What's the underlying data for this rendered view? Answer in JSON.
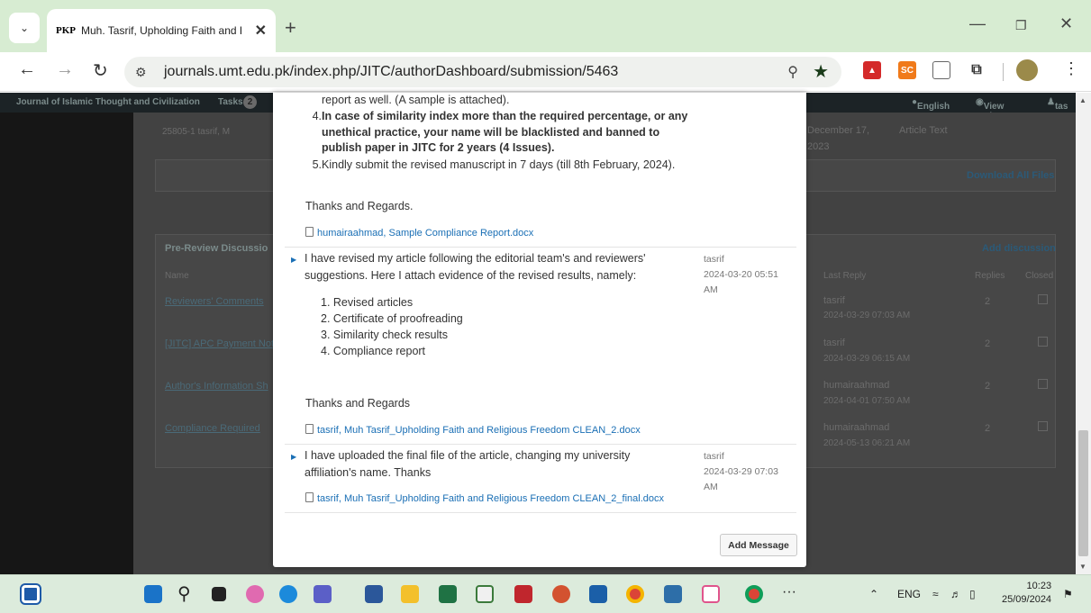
{
  "browser": {
    "tab_title": "Muh. Tasrif, Upholding Faith and Relig",
    "tab_favicon": "PKP",
    "url": "journals.umt.edu.pk/index.php/JITC/authorDashboard/submission/5463",
    "ext_sc": "SC"
  },
  "site": {
    "journal_name": "Journal of Islamic Thought and Civilization",
    "tasks_label": "Tasks",
    "tasks_count": "2",
    "lang": "English",
    "view_site": "View Site",
    "user": "tas",
    "file_row": "25805-1   tasrif, M",
    "file_date": "December 17,",
    "file_year": "2023",
    "file_type": "Article Text",
    "download_all": "Download All Files",
    "discussions_title": "Pre-Review Discussio",
    "add_discussion": "Add discussion",
    "col_name": "Name",
    "col_last_reply": "Last Reply",
    "col_replies": "Replies",
    "col_closed": "Closed",
    "rows": [
      {
        "name": "Reviewers' Comments",
        "user": "tasrif",
        "date": "2024-03-29 07:03 AM",
        "replies": "2"
      },
      {
        "name": "[JITC] APC Payment Noti",
        "user": "tasrif",
        "date": "2024-03-29 06:15 AM",
        "replies": "2"
      },
      {
        "name": "Author's Information Sh",
        "user": "humairaahmad",
        "date": "2024-04-01 07:50 AM",
        "replies": "2"
      },
      {
        "name": "Compliance Required",
        "user": "humairaahmad",
        "date": "2024-05-13 06:21 AM",
        "replies": "2"
      }
    ]
  },
  "modal": {
    "item3_tail": "report as well. (A sample is attached).",
    "item4_num": "4.",
    "item4_text": "In case of similarity index more than the required percentage, or any unethical practice, your name will be blacklisted and banned to publish paper in JITC for 2 years (4 Issues).",
    "item5_num": "5.",
    "item5_text": "Kindly submit the revised manuscript in 7 days (till 8th February, 2024).",
    "thanks1": "Thanks and Regards.",
    "attach1": "humairaahmad, Sample Compliance Report.docx",
    "msg2": {
      "text": "I have revised my article following the editorial team's and reviewers' suggestions. Here I attach evidence of the revised results, namely:",
      "author": "tasrif",
      "date": "2024-03-20 05:51",
      "time": "AM",
      "items": [
        "1. Revised articles",
        "2. Certificate of proofreading",
        "3. Similarity check results",
        "4. Compliance report"
      ],
      "thanks": "Thanks and Regards",
      "attach": "tasrif, Muh Tasrif_Upholding Faith and Religious Freedom CLEAN_2.docx"
    },
    "msg3": {
      "text": "I have uploaded the final file of the article, changing my university affiliation's name. Thanks",
      "author": "tasrif",
      "date": "2024-03-29 07:03",
      "time": "AM",
      "attach": "tasrif, Muh Tasrif_Upholding Faith and Religious Freedom CLEAN_2_final.docx"
    },
    "add_message": "Add Message"
  },
  "taskbar": {
    "lang": "ENG",
    "time": "10:23",
    "date": "25/09/2024",
    "more": "···"
  }
}
